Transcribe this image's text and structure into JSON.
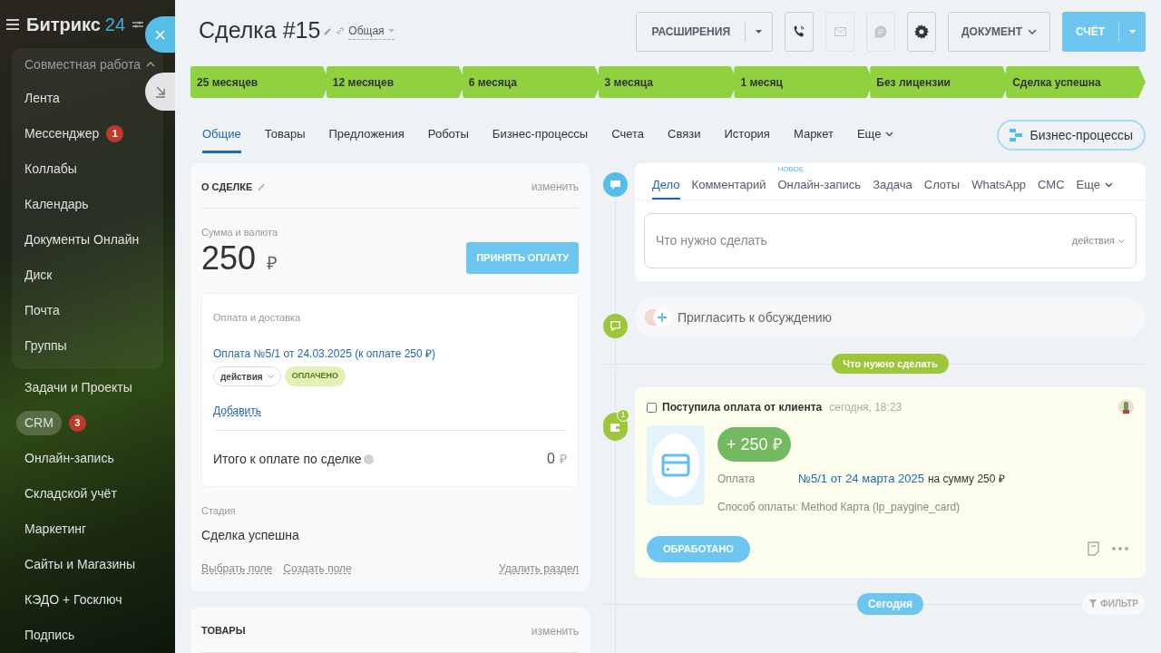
{
  "sidebar": {
    "logo": {
      "name": "Битрикс",
      "number": "24"
    },
    "group": {
      "label": "Совместная работа",
      "expanded": true,
      "items": [
        {
          "label": "Лента"
        },
        {
          "label": "Мессенджер",
          "counter": "1"
        },
        {
          "label": "Коллабы"
        },
        {
          "label": "Календарь"
        },
        {
          "label": "Документы Онлайн"
        },
        {
          "label": "Диск"
        },
        {
          "label": "Почта"
        },
        {
          "label": "Группы"
        }
      ]
    },
    "items": [
      {
        "label": "Задачи и Проекты",
        "selected": false
      },
      {
        "label": "CRM",
        "counter": "3",
        "selected": true
      },
      {
        "label": "Онлайн-запись",
        "selected": false
      },
      {
        "label": "Складской учёт",
        "selected": false
      },
      {
        "label": "Маркетинг",
        "selected": false
      },
      {
        "label": "Сайты и Магазины",
        "selected": false
      },
      {
        "label": "КЭДО + Госключ",
        "selected": false
      },
      {
        "label": "Подпись",
        "selected": false
      }
    ]
  },
  "header": {
    "title": "Сделка #15",
    "access": "Общая",
    "buttons": [
      {
        "kind": "split",
        "label": "РАСШИРЕНИЯ",
        "disabled": false
      },
      {
        "kind": "phone",
        "disabled": false
      },
      {
        "kind": "mail",
        "disabled": true
      },
      {
        "kind": "chat",
        "disabled": true
      },
      {
        "kind": "gear",
        "disabled": false
      },
      {
        "kind": "dropdown",
        "label": "ДОКУМЕНТ",
        "disabled": false
      },
      {
        "kind": "primary",
        "label": "СЧЁТ",
        "disabled": false
      }
    ]
  },
  "stages": [
    {
      "label": "25 месяцев",
      "color": "#8fd13f"
    },
    {
      "label": "12 месяцев",
      "color": "#8fd13f"
    },
    {
      "label": "6 месяца",
      "color": "#8fd13f"
    },
    {
      "label": "3 месяца",
      "color": "#8fd13f"
    },
    {
      "label": "1 месяц",
      "color": "#8fd13f"
    },
    {
      "label": "Без лицензии",
      "color": "#8fd13f"
    },
    {
      "label": "Сделка успешна",
      "color": "#8fd13f"
    }
  ],
  "tabs": [
    {
      "label": "Общие",
      "selected": true
    },
    {
      "label": "Товары",
      "selected": false
    },
    {
      "label": "Предложения",
      "selected": false
    },
    {
      "label": "Роботы",
      "selected": false
    },
    {
      "label": "Бизнес-процессы",
      "selected": false
    },
    {
      "label": "Счета",
      "selected": false
    },
    {
      "label": "Связи",
      "selected": false
    },
    {
      "label": "История",
      "selected": false
    },
    {
      "label": "Маркет",
      "selected": false
    },
    {
      "label": "Еще",
      "selected": false
    }
  ],
  "bp_button": "Бизнес-процессы",
  "deal_card": {
    "title": "О СДЕЛКЕ",
    "edit": "изменить",
    "amount_label": "Сумма и валюта",
    "amount": "250",
    "currency": "₽",
    "accept_button": "ПРИНЯТЬ ОПЛАТУ",
    "payment": {
      "title": "Оплата и доставка",
      "link": "Оплата №5/1 от 24.03.2025 (к оплате 250 ₽)",
      "actions": "действия",
      "status": "ОПЛАЧЕНО",
      "add": "Добавить",
      "total_label": "Итого к оплате по сделке",
      "total": "0",
      "total_currency": "₽"
    },
    "stage_label": "Стадия",
    "stage": "Сделка успешна",
    "links": [
      "Выбрать поле",
      "Создать поле"
    ],
    "delete": "Удалить раздел"
  },
  "products_card": {
    "title": "ТОВАРЫ",
    "edit": "изменить"
  },
  "timeline": {
    "tabs": [
      {
        "label": "Дело",
        "selected": true
      },
      {
        "label": "Комментарий",
        "selected": false
      },
      {
        "label": "Онлайн-запись",
        "selected": false,
        "badge": "НОВОЕ"
      },
      {
        "label": "Задача",
        "selected": false
      },
      {
        "label": "Слоты",
        "selected": false
      },
      {
        "label": "WhatsApp",
        "selected": false
      },
      {
        "label": "СМС",
        "selected": false
      },
      {
        "label": "Еще",
        "selected": false
      }
    ],
    "placeholder": "Что нужно сделать",
    "actions": "действия",
    "invite": "Пригласить к обсуждению",
    "todo_divider": "Что нужно сделать",
    "event": {
      "counter": "1",
      "checked": false,
      "title": "Поступила оплата от клиента",
      "time": "сегодня, 18:23",
      "amount": "+ 250 ₽",
      "payment_label": "Оплата",
      "payment_link": "№5/1 от 24 марта 2025",
      "payment_rest": "на сумму 250 ₽",
      "method": "Способ оплаты: Method Карта (lp_paygine_card)",
      "button": "ОБРАБОТАНО"
    },
    "today": "Сегодня",
    "filter": "ФИЛЬТР"
  }
}
